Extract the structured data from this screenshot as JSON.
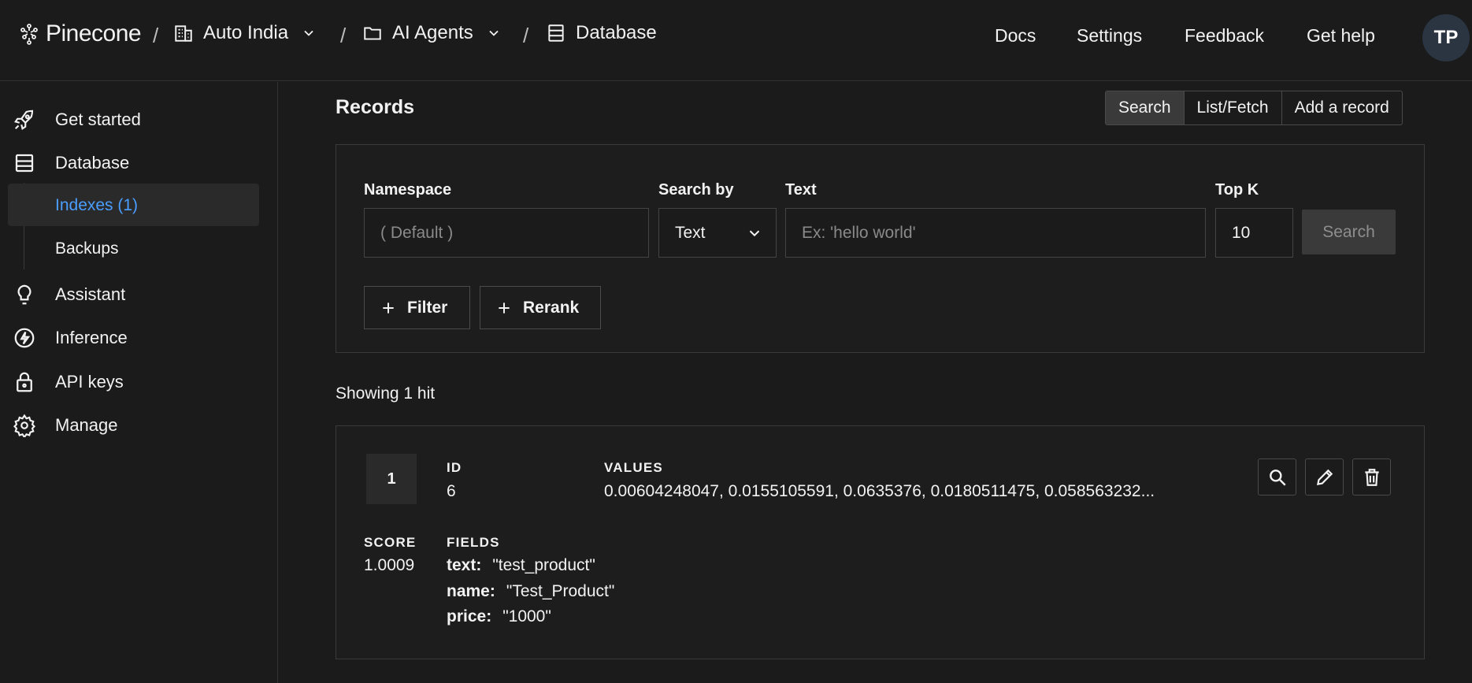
{
  "header": {
    "brand": "Pinecone",
    "breadcrumbs": [
      {
        "label": "Auto India",
        "icon": "building-icon"
      },
      {
        "label": "AI Agents",
        "icon": "folder-icon"
      },
      {
        "label": "Database",
        "icon": "database-icon"
      }
    ],
    "separator": "/",
    "nav": [
      "Docs",
      "Settings",
      "Feedback",
      "Get help"
    ],
    "avatar": "TP"
  },
  "sidebar": {
    "items": [
      {
        "label": "Get started",
        "icon": "rocket-icon"
      },
      {
        "label": "Database",
        "icon": "database-icon"
      },
      {
        "label": "Assistant",
        "icon": "lightbulb-icon"
      },
      {
        "label": "Inference",
        "icon": "bolt-icon"
      },
      {
        "label": "API keys",
        "icon": "lock-icon"
      },
      {
        "label": "Manage",
        "icon": "gear-icon"
      }
    ],
    "sub_items": [
      {
        "label": "Indexes (1)",
        "active": true
      },
      {
        "label": "Backups",
        "active": false
      }
    ]
  },
  "records": {
    "title": "Records",
    "tabs": [
      "Search",
      "List/Fetch",
      "Add a record"
    ],
    "active_tab": "Search"
  },
  "search_form": {
    "namespace_label": "Namespace",
    "namespace_placeholder": "( Default )",
    "search_by_label": "Search by",
    "search_by_value": "Text",
    "text_label": "Text",
    "text_placeholder": "Ex: 'hello world'",
    "topk_label": "Top K",
    "topk_value": "10",
    "search_button": "Search",
    "filter_button": "Filter",
    "rerank_button": "Rerank"
  },
  "results": {
    "summary": "Showing 1 hit",
    "hits": [
      {
        "rank": "1",
        "id_label": "ID",
        "id": "6",
        "values_label": "VALUES",
        "values": "0.00604248047, 0.0155105591, 0.0635376, 0.0180511475, 0.058563232...",
        "score_label": "SCORE",
        "score": "1.0009",
        "fields_label": "FIELDS",
        "fields": [
          {
            "key": "text:",
            "value": "\"test_product\""
          },
          {
            "key": "name:",
            "value": "\"Test_Product\""
          },
          {
            "key": "price:",
            "value": "\"1000\""
          }
        ]
      }
    ]
  },
  "colors": {
    "background": "#1b1b1b",
    "active_link": "#4a9eff",
    "border": "#3a3a3a"
  }
}
